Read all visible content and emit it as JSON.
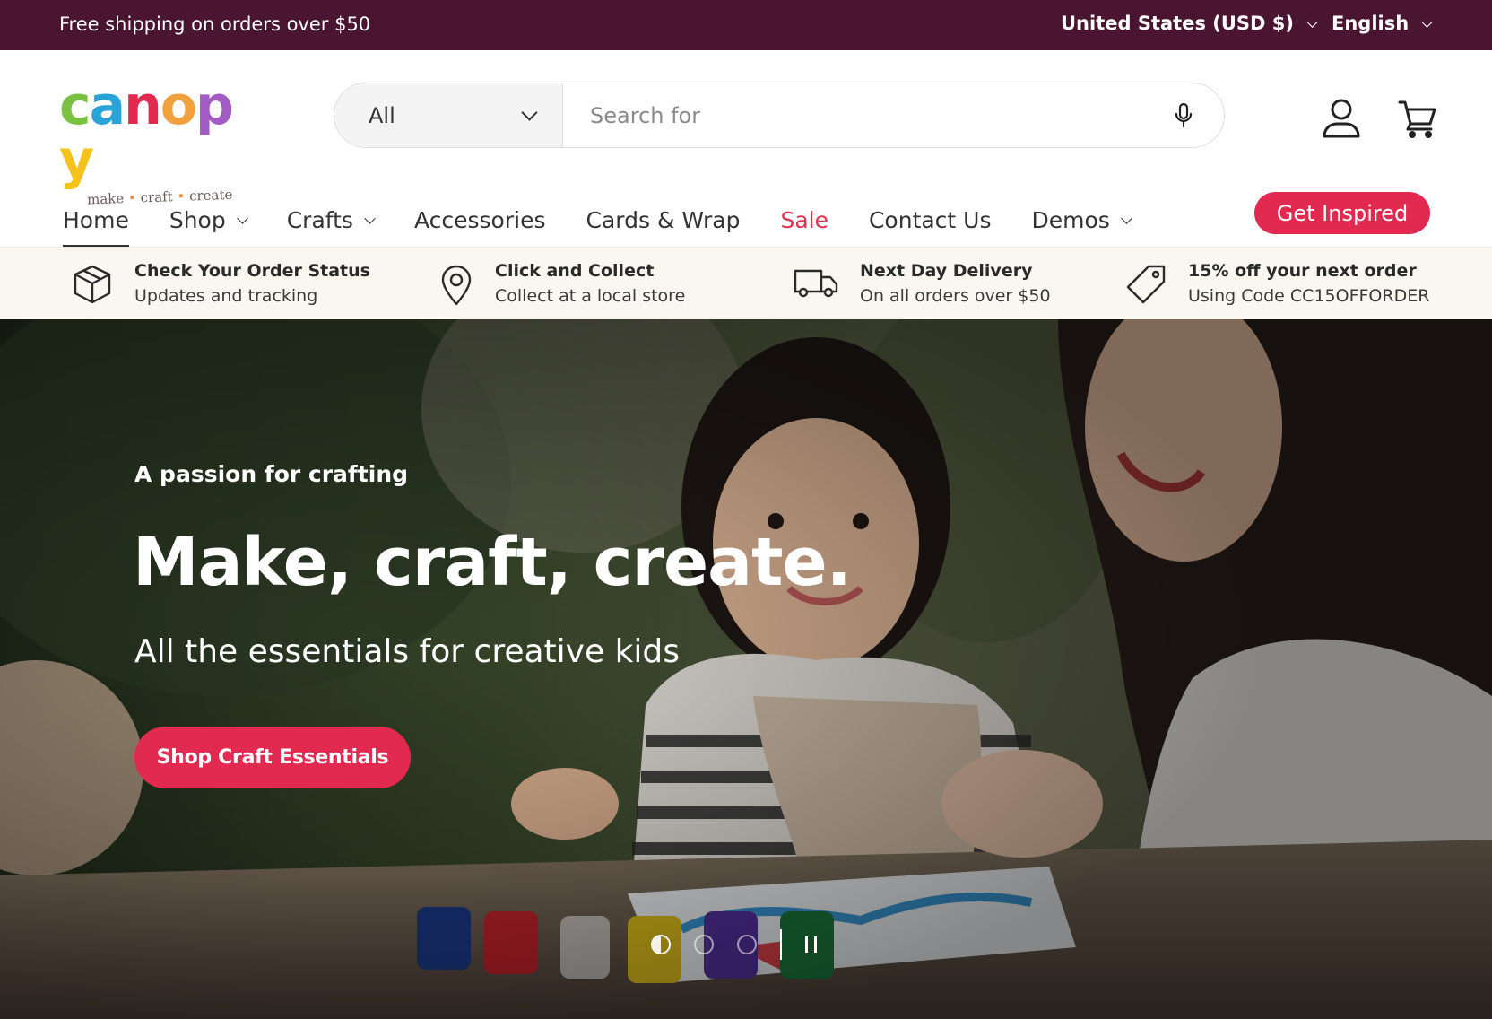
{
  "announcement": {
    "message": "Free shipping on orders over $50",
    "currency": "United States (USD $)",
    "language": "English"
  },
  "logo": {
    "word": [
      "c",
      "a",
      "n",
      "o",
      "p",
      "y"
    ],
    "colors": [
      "#7ac142",
      "#2aa4d8",
      "#e2294f",
      "#f0a03c",
      "#a35bc4",
      "#f4c21a"
    ],
    "tagline_parts": [
      "make",
      "craft",
      "create"
    ]
  },
  "search": {
    "scope": "All",
    "placeholder": "Search for"
  },
  "nav": {
    "items": [
      {
        "label": "Home"
      },
      {
        "label": "Shop"
      },
      {
        "label": "Crafts"
      },
      {
        "label": "Accessories"
      },
      {
        "label": "Cards & Wrap"
      },
      {
        "label": "Sale"
      },
      {
        "label": "Contact Us"
      },
      {
        "label": "Demos"
      }
    ],
    "cta": "Get Inspired"
  },
  "usp": [
    {
      "title": "Check Your Order Status",
      "subtitle": "Updates and tracking",
      "icon": "box-icon"
    },
    {
      "title": "Click and Collect",
      "subtitle": "Collect at a local store",
      "icon": "map-pin-icon"
    },
    {
      "title": "Next Day Delivery",
      "subtitle": "On all orders over $50",
      "icon": "truck-icon"
    },
    {
      "title": "15% off your next order",
      "subtitle": "Using Code CC15OFFORDER",
      "icon": "tag-icon"
    }
  ],
  "hero": {
    "kicker": "A passion for crafting",
    "heading": "Make, craft, create.",
    "subheading": "All the essentials for creative kids",
    "button": "Shop Craft Essentials",
    "slide_count": 3,
    "active_slide": 1
  },
  "colors": {
    "announcement_bg": "#4a1530",
    "accent": "#e2294f",
    "sale": "#e03250",
    "usp_bg": "#f9f7f0"
  }
}
